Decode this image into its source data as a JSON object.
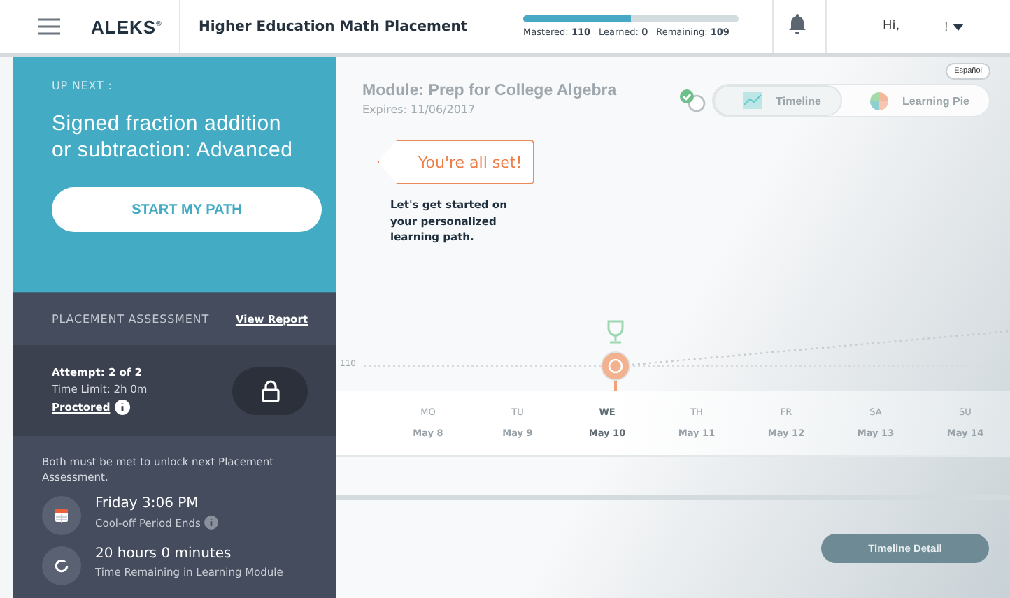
{
  "header": {
    "logo": "ALEKS",
    "logo_mark": "®",
    "title": "Higher Education Math Placement",
    "progress": {
      "level": 0.5,
      "stats": [
        {
          "label": "Mastered:",
          "value": "110"
        },
        {
          "label": "Learned:",
          "value": "0"
        },
        {
          "label": "Remaining:",
          "value": "109"
        }
      ]
    },
    "greeting": "Hi,",
    "user_menu": "!"
  },
  "up_next": {
    "heading": "UP NEXT :",
    "topic": "Signed fraction addition or subtraction: Advanced",
    "button": "START MY PATH"
  },
  "assessment": {
    "heading": "PLACEMENT ASSESSMENT",
    "report_link": "View Report",
    "attempt": "Attempt: 2 of 2",
    "time_limit": "Time Limit: 2h 0m",
    "proctored": "Proctored",
    "note": "Both must be met to unlock next Placement Assessment.",
    "conditions": [
      {
        "kind": "calendar",
        "title": "Friday 3:06 PM",
        "caption": "Cool-off Period Ends",
        "info": true
      },
      {
        "kind": "timer",
        "title": "20 hours 0 minutes",
        "caption": "Time Remaining in Learning Module",
        "info": false
      }
    ]
  },
  "module": {
    "language_button": "Español",
    "title": "Module: Prep for College Algebra",
    "expires": "Expires: 11/06/2017",
    "view_toggle": [
      {
        "kind": "timeline",
        "label": "Timeline",
        "selected": true
      },
      {
        "kind": "pie",
        "label": "Learning Pie",
        "selected": false
      }
    ],
    "callout": "You're all set!",
    "message": "Let's get started on your personalized learning path.",
    "goal_label": "110",
    "days": [
      {
        "day": "MO",
        "date": "May 8",
        "selected": false
      },
      {
        "day": "TU",
        "date": "May 9",
        "selected": false
      },
      {
        "day": "WE",
        "date": "May 10",
        "selected": true
      },
      {
        "day": "TH",
        "date": "May 11",
        "selected": false
      },
      {
        "day": "FR",
        "date": "May 12",
        "selected": false
      },
      {
        "day": "SA",
        "date": "May 13",
        "selected": false
      },
      {
        "day": "SU",
        "date": "May 14",
        "selected": false
      }
    ],
    "detail_button": "Timeline Detail"
  }
}
